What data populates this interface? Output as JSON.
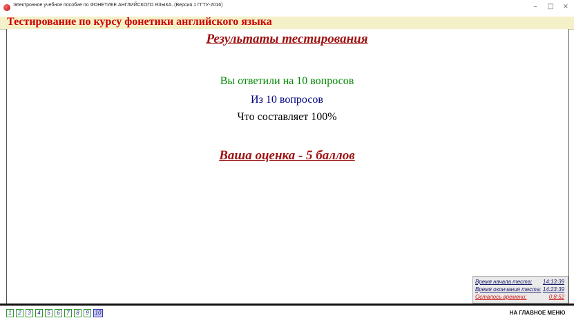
{
  "window": {
    "title": "Электронное учебное пособие по ФОНЕТИКЕ АНГЛИЙСКОГО ЯЗЫКА. (Версия 1   ГГТУ-2016)",
    "minimize": "–",
    "maximize": "□",
    "close": "×"
  },
  "header": {
    "title": "Тестирование по курсу фонетики английского языка"
  },
  "results": {
    "heading": "Результаты тестирования",
    "answered": "Вы ответили на 10 вопросов",
    "of_total": "Из 10 вопросов",
    "percent": "Что составляет 100%",
    "grade": "Ваша оценка - 5 баллов"
  },
  "timer": {
    "start_label": "Время начала теста:",
    "start_value": "14:13:39",
    "end_label": "Время окончания теста:",
    "end_value": "14:23:39",
    "remaining_label": "Осталось времени:",
    "remaining_value": "0:8:52"
  },
  "question_nav": [
    "1",
    "2",
    "3",
    "4",
    "5",
    "6",
    "7",
    "8",
    "9",
    "10"
  ],
  "current_question": "10",
  "main_menu_label": "НА ГЛАВНОЕ МЕНЮ",
  "colors": {
    "header_bg": "#f4f1c9",
    "header_text": "#cc0000",
    "heading_text": "#9e1010",
    "answered_text": "#008800",
    "of_total_text": "#000080"
  }
}
